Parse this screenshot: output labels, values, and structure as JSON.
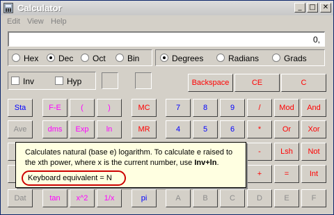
{
  "window": {
    "title": "Calculator",
    "minimize_glyph": "_",
    "maximize_glyph": "□",
    "close_glyph": "✕"
  },
  "menu": [
    {
      "label": "Edit"
    },
    {
      "label": "View"
    },
    {
      "label": "Help"
    }
  ],
  "display": {
    "value": "0,"
  },
  "number_system": [
    {
      "label": "Hex",
      "selected": false
    },
    {
      "label": "Dec",
      "selected": true
    },
    {
      "label": "Oct",
      "selected": false
    },
    {
      "label": "Bin",
      "selected": false
    }
  ],
  "angle_unit": [
    {
      "label": "Degrees",
      "selected": true
    },
    {
      "label": "Radians",
      "selected": false
    },
    {
      "label": "Grads",
      "selected": false
    }
  ],
  "toggles": [
    {
      "label": "Inv",
      "checked": false
    },
    {
      "label": "Hyp",
      "checked": false
    }
  ],
  "edit_buttons": {
    "backspace": "Backspace",
    "ce": "CE",
    "c": "C"
  },
  "keys": {
    "sta": "Sta",
    "fe": "F-E",
    "lparen": "(",
    "rparen": ")",
    "ave": "Ave",
    "dms": "dms",
    "exp": "Exp",
    "ln": "ln",
    "dat": "Dat",
    "tan": "tan",
    "xsq": "x^2",
    "recip": "1/x",
    "mc": "MC",
    "mr": "MR",
    "pi": "pi",
    "n7": "7",
    "n8": "8",
    "n9": "9",
    "div": "/",
    "mod": "Mod",
    "and": "And",
    "n4": "4",
    "n5": "5",
    "n6": "6",
    "mul": "*",
    "or": "Or",
    "xor": "Xor",
    "sub": "-",
    "lsh": "Lsh",
    "not": "Not",
    "add": "+",
    "eq": "=",
    "int": "Int",
    "a": "A",
    "b": "B",
    "c": "C",
    "d": "D",
    "e": "E",
    "f": "F"
  },
  "tooltip": {
    "text": "Calculates natural (base e) logarithm. To calculate e raised to the xth power, where x is the current number, use ",
    "bold_text": "Inv+ln",
    "text_end": ".",
    "keyboard_equivalent": "Keyboard equivalent = N"
  },
  "colors": {
    "function_key": "#ff00ff",
    "digit_key": "#0000ff",
    "operator_key": "#ff0000",
    "disabled_key": "#8c8c8c",
    "tooltip_bg": "#ffffe1",
    "highlight": "#cc0000"
  }
}
